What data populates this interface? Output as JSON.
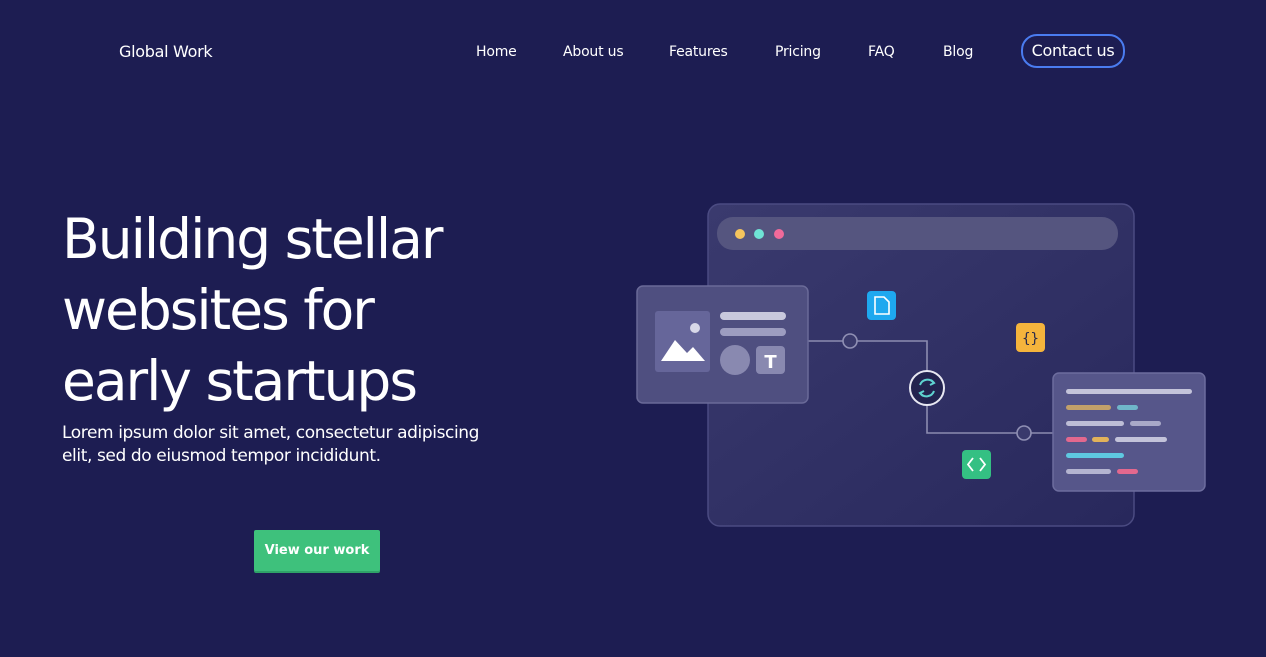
{
  "header": {
    "brand": "Global Work",
    "nav": [
      {
        "label": "Home"
      },
      {
        "label": "About us"
      },
      {
        "label": "Features"
      },
      {
        "label": "Pricing"
      },
      {
        "label": "FAQ"
      },
      {
        "label": "Blog"
      }
    ],
    "contact_label": "Contact us"
  },
  "hero": {
    "title_lines": [
      "Building stellar",
      "websites for",
      "early startups"
    ],
    "subtitle": "Lorem ipsum dolor sit amet, consectetur adipiscing elit, sed do eiusmod tempor incididunt.",
    "cta_label": "View our work"
  },
  "illustration": {
    "window_dots": [
      "#f6c55d",
      "#6fe3d5",
      "#f06a9a"
    ],
    "icons": [
      "image-icon",
      "text-icon",
      "file-icon",
      "braces-icon",
      "sync-icon",
      "code-icon"
    ]
  },
  "colors": {
    "background": "#1d1d52",
    "accent_border": "#4a7cf0",
    "cta": "#3ec17c"
  }
}
